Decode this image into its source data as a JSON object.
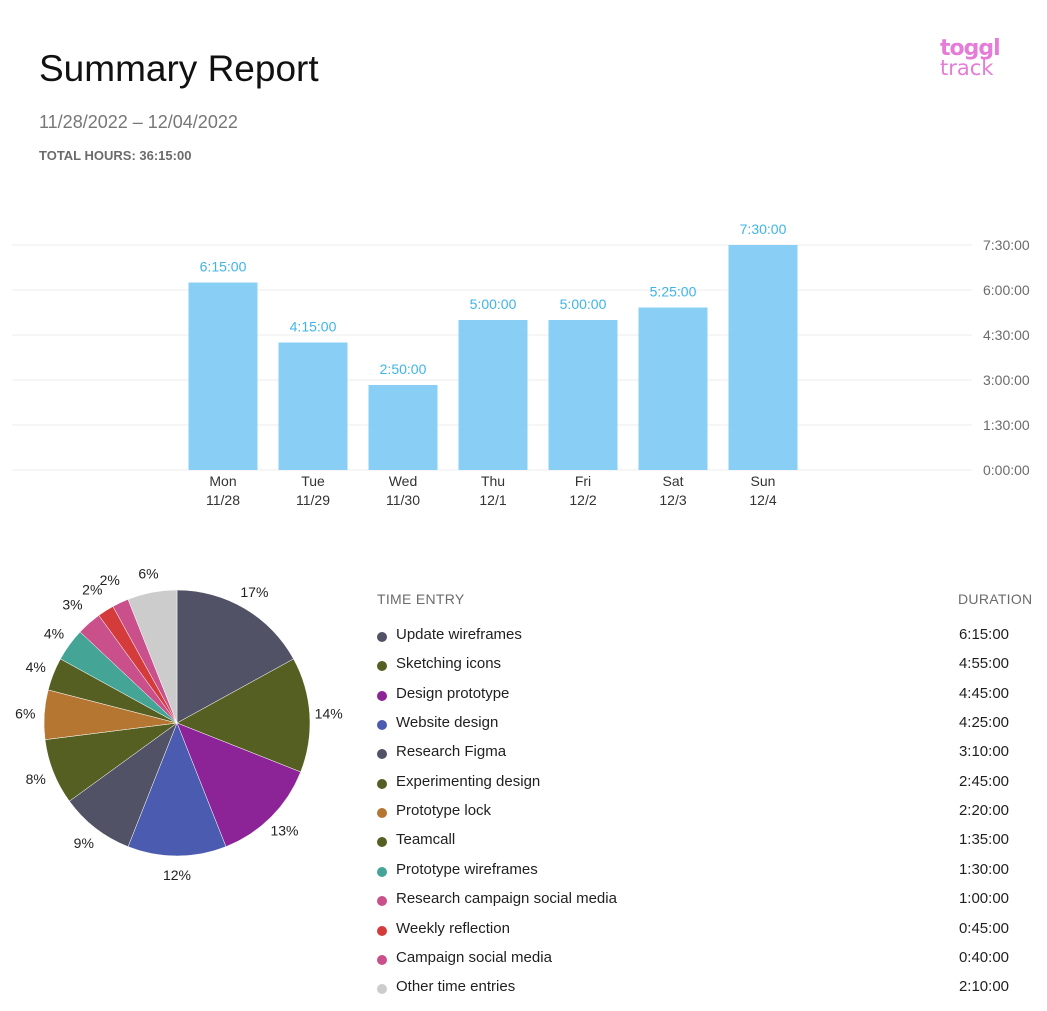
{
  "header": {
    "title": "Summary Report",
    "date_range": "11/28/2022 – 12/04/2022",
    "total_hours": "TOTAL HOURS: 36:15:00",
    "logo_line1": "toggl",
    "logo_line2": "track"
  },
  "colors": {
    "bar": "#89cff5",
    "bar_label": "#3fb4ea",
    "grid": "#ececec",
    "axis_text": "#6b6b6b"
  },
  "chart_data": [
    {
      "type": "bar",
      "categories": [
        "Mon",
        "Tue",
        "Wed",
        "Thu",
        "Fri",
        "Sat",
        "Sun"
      ],
      "category_dates": [
        "11/28",
        "11/29",
        "11/30",
        "12/1",
        "12/2",
        "12/3",
        "12/4"
      ],
      "values": [
        6.25,
        4.25,
        2.8333,
        5.0,
        5.0,
        5.4167,
        7.5
      ],
      "value_labels": [
        "6:15:00",
        "4:15:00",
        "2:50:00",
        "5:00:00",
        "5:00:00",
        "5:25:00",
        "7:30:00"
      ],
      "yticks": [
        0,
        1.5,
        3,
        4.5,
        6,
        7.5
      ],
      "ytick_labels": [
        "0:00:00",
        "1:30:00",
        "3:00:00",
        "4:30:00",
        "6:00:00",
        "7:30:00"
      ],
      "ylim": [
        0,
        7.5
      ],
      "grid": true,
      "y_axis_side": "right"
    },
    {
      "type": "pie",
      "start": "12 o'clock, clockwise",
      "slices": [
        {
          "label": "17%",
          "value": 17,
          "color": "#525266"
        },
        {
          "label": "14%",
          "value": 14,
          "color": "#555f22"
        },
        {
          "label": "13%",
          "value": 13,
          "color": "#8c2397"
        },
        {
          "label": "12%",
          "value": 12,
          "color": "#4a5bb0"
        },
        {
          "label": "9%",
          "value": 9,
          "color": "#525266"
        },
        {
          "label": "8%",
          "value": 8,
          "color": "#555f22"
        },
        {
          "label": "6%",
          "value": 6,
          "color": "#b47630"
        },
        {
          "label": "4%",
          "value": 4,
          "color": "#555f22"
        },
        {
          "label": "4%",
          "value": 4,
          "color": "#44a596"
        },
        {
          "label": "3%",
          "value": 3,
          "color": "#c9508a"
        },
        {
          "label": "2%",
          "value": 2,
          "color": "#d43c3c"
        },
        {
          "label": "2%",
          "value": 2,
          "color": "#c9508a"
        },
        {
          "label": "6%",
          "value": 6,
          "color": "#cccccc"
        }
      ]
    }
  ],
  "table": {
    "header_entry": "TIME ENTRY",
    "header_duration": "DURATION",
    "rows": [
      {
        "name": "Update wireframes",
        "duration": "6:15:00",
        "color": "#525266"
      },
      {
        "name": "Sketching icons",
        "duration": "4:55:00",
        "color": "#555f22"
      },
      {
        "name": "Design prototype",
        "duration": "4:45:00",
        "color": "#8c2397"
      },
      {
        "name": "Website design",
        "duration": "4:25:00",
        "color": "#4a5bb0"
      },
      {
        "name": "Research Figma",
        "duration": "3:10:00",
        "color": "#525266"
      },
      {
        "name": "Experimenting design",
        "duration": "2:45:00",
        "color": "#555f22"
      },
      {
        "name": "Prototype lock",
        "duration": "2:20:00",
        "color": "#b47630"
      },
      {
        "name": "Teamcall",
        "duration": "1:35:00",
        "color": "#555f22"
      },
      {
        "name": "Prototype wireframes",
        "duration": "1:30:00",
        "color": "#44a596"
      },
      {
        "name": "Research campaign social media",
        "duration": "1:00:00",
        "color": "#c9508a"
      },
      {
        "name": "Weekly reflection",
        "duration": "0:45:00",
        "color": "#d43c3c"
      },
      {
        "name": "Campaign social media",
        "duration": "0:40:00",
        "color": "#c9508a"
      },
      {
        "name": "Other time entries",
        "duration": "2:10:00",
        "color": "#cccccc"
      }
    ]
  }
}
